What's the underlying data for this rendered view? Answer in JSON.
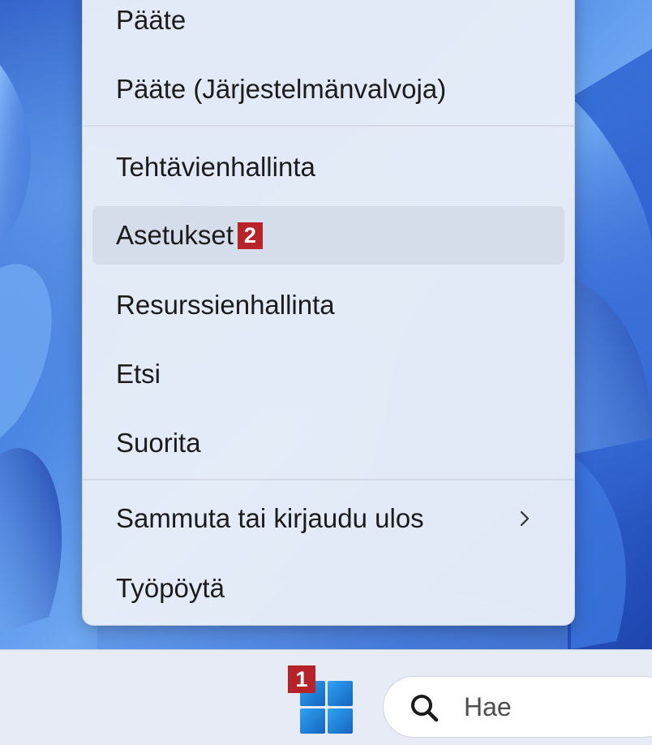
{
  "context_menu": {
    "items": [
      {
        "label": "Pääte"
      },
      {
        "label": "Pääte (Järjestelmänvalvoja)"
      },
      {
        "label": "Tehtävienhallinta"
      },
      {
        "label": "Asetukset",
        "badge": "2"
      },
      {
        "label": "Resurssienhallinta"
      },
      {
        "label": "Etsi"
      },
      {
        "label": "Suorita"
      },
      {
        "label": "Sammuta tai kirjaudu ulos",
        "submenu_icon": "chevron-right-icon"
      },
      {
        "label": "Työpöytä"
      }
    ]
  },
  "taskbar": {
    "start_badge": "1",
    "start_icon": "windows-logo-icon",
    "search": {
      "icon": "search-icon",
      "placeholder": "Hae"
    }
  },
  "colors": {
    "badge": "#b8232a",
    "menu_background": "#e9eef8",
    "hover_background": "#d3dae8",
    "windows_logo": "#1e88e5"
  }
}
